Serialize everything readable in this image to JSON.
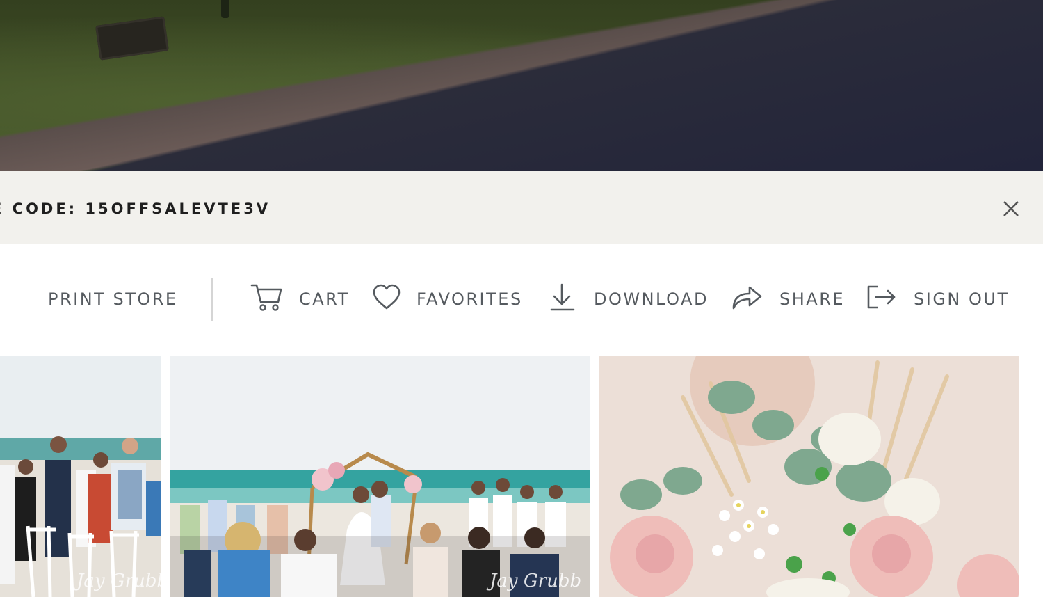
{
  "promo": {
    "text": "E CODE: 15OFFSALEVTE3V",
    "close_label": "close"
  },
  "nav": {
    "print_store": "PRINT STORE",
    "cart": "CART",
    "favorites": "FAVORITES",
    "download": "DOWNLOAD",
    "share": "SHARE",
    "sign_out": "SIGN OUT"
  },
  "icons": {
    "cart": "cart-icon",
    "favorites": "heart-icon",
    "download": "download-icon",
    "share": "share-arrow-icon",
    "sign_out": "sign-out-icon",
    "close": "close-icon"
  },
  "gallery": {
    "photos": [
      {
        "subject": "wedding guests on beach"
      },
      {
        "subject": "beach wedding ceremony kiss under arch"
      },
      {
        "subject": "bridal bouquet close-up"
      }
    ]
  },
  "colors": {
    "promo_bg": "#f2f1ed",
    "nav_text": "#555a5f",
    "promo_text": "#1f1f1f"
  }
}
